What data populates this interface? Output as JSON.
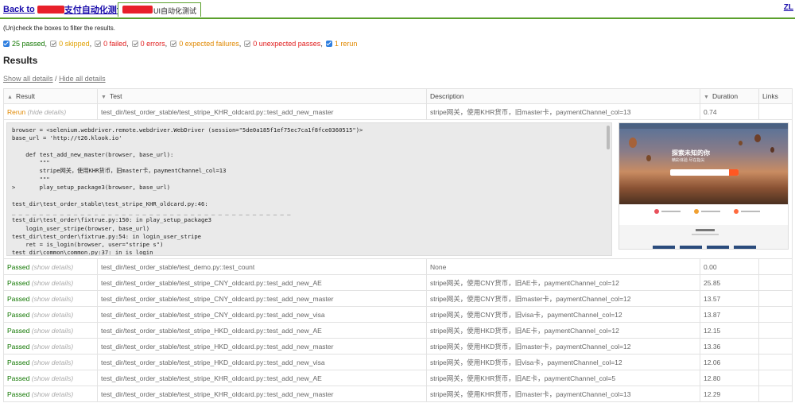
{
  "top": {
    "back_prefix": "Back to",
    "back_suffix": "支付自动化测试",
    "tab_label": "UI自动化测试",
    "right_link": "ZL"
  },
  "filter_hint": "(Un)check the boxes to filter the results.",
  "filters": [
    {
      "label": "25 passed",
      "checked": true,
      "color": "#117700"
    },
    {
      "label": "0 skipped",
      "checked": false,
      "color": "#e0a000"
    },
    {
      "label": "0 failed",
      "checked": false,
      "color": "#e01c1c"
    },
    {
      "label": "0 errors",
      "checked": false,
      "color": "#e01c1c"
    },
    {
      "label": "0 expected failures",
      "checked": false,
      "color": "#e08800"
    },
    {
      "label": "0 unexpected passes",
      "checked": false,
      "color": "#e01c1c"
    },
    {
      "label": "1 rerun",
      "checked": true,
      "color": "#e08800"
    }
  ],
  "results_heading": "Results",
  "details": {
    "show_all": "Show all details",
    "slash": " / ",
    "hide_all": "Hide all details"
  },
  "table": {
    "headers": {
      "result": "Result",
      "test": "Test",
      "description": "Description",
      "duration": "Duration",
      "links": "Links"
    },
    "rerun_row": {
      "result": "Rerun",
      "toggle": "(hide details)",
      "test": "test_dir/test_order_stable/test_stripe_KHR_oldcard.py::test_add_new_master",
      "description": "stripe网关，使用KHR货币，旧master卡，paymentChannel_col=13",
      "duration": "0.74"
    },
    "log_text": "browser = <selenium.webdriver.remote.webdriver.WebDriver (session=\"5de0a185f1ef75ec7ca1f8fce0360515\")>\nbase_url = 'http://t26.klook.io'\n\n    def test_add_new_master(browser, base_url):\n        \"\"\"\n        stripe网关，使用KHR货币，旧master卡，paymentChannel_col=13\n        \"\"\"\n>       play_setup_package3(browser, base_url)\n\ntest_dir\\test_order_stable\\test_stripe_KHR_oldcard.py:46:\n_ _ _ _ _ _ _ _ _ _ _ _ _ _ _ _ _ _ _ _ _ _ _ _ _ _ _ _ _ _ _ _ _ _ _ _ _ _ _ _ _\ntest_dir\\test_order\\fixtrue.py:150: in play_setup_package3\n    login_user_stripe(browser, base_url)\ntest_dir\\test_order\\fixtrue.py:54: in login_user_stripe\n    ret = is_login(browser, user=\"stripe s\")\ntest_dir\\common\\common.py:37: in is_login\n    if menu_text in list):",
    "shot": {
      "title": "探索未知的你",
      "sub": "精彩体验 尽在指尖"
    },
    "rows": [
      {
        "result": "Passed",
        "toggle": "(show details)",
        "test": "test_dir/test_order_stable/test_demo.py::test_count",
        "description": "None",
        "duration": "0.00"
      },
      {
        "result": "Passed",
        "toggle": "(show details)",
        "test": "test_dir/test_order_stable/test_stripe_CNY_oldcard.py::test_add_new_AE",
        "description": "stripe网关，使用CNY货币，旧AE卡，paymentChannel_col=12",
        "duration": "25.85"
      },
      {
        "result": "Passed",
        "toggle": "(show details)",
        "test": "test_dir/test_order_stable/test_stripe_CNY_oldcard.py::test_add_new_master",
        "description": "stripe网关，使用CNY货币，旧master卡，paymentChannel_col=12",
        "duration": "13.57"
      },
      {
        "result": "Passed",
        "toggle": "(show details)",
        "test": "test_dir/test_order_stable/test_stripe_CNY_oldcard.py::test_add_new_visa",
        "description": "stripe网关，使用CNY货币，旧visa卡，paymentChannel_col=12",
        "duration": "13.87"
      },
      {
        "result": "Passed",
        "toggle": "(show details)",
        "test": "test_dir/test_order_stable/test_stripe_HKD_oldcard.py::test_add_new_AE",
        "description": "stripe网关，使用HKD货币，旧AE卡，paymentChannel_col=12",
        "duration": "12.15"
      },
      {
        "result": "Passed",
        "toggle": "(show details)",
        "test": "test_dir/test_order_stable/test_stripe_HKD_oldcard.py::test_add_new_master",
        "description": "stripe网关，使用HKD货币，旧master卡，paymentChannel_col=12",
        "duration": "13.36"
      },
      {
        "result": "Passed",
        "toggle": "(show details)",
        "test": "test_dir/test_order_stable/test_stripe_HKD_oldcard.py::test_add_new_visa",
        "description": "stripe网关，使用HKD货币，旧visa卡，paymentChannel_col=12",
        "duration": "12.06"
      },
      {
        "result": "Passed",
        "toggle": "(show details)",
        "test": "test_dir/test_order_stable/test_stripe_KHR_oldcard.py::test_add_new_AE",
        "description": "stripe网关，使用KHR货币，旧AE卡，paymentChannel_col=5",
        "duration": "12.80"
      },
      {
        "result": "Passed",
        "toggle": "(show details)",
        "test": "test_dir/test_order_stable/test_stripe_KHR_oldcard.py::test_add_new_master",
        "description": "stripe网关，使用KHR货币，旧master卡，paymentChannel_col=13",
        "duration": "12.29"
      }
    ]
  },
  "colors": {
    "accent_green": "#5aa02c",
    "link_blue": "#1a0dab",
    "redaction": "#e8202a",
    "checkbox_blue": "#2f7fe0"
  },
  "icons": {
    "sort": "sort-arrow-icon",
    "checkbox": "checkbox-icon"
  }
}
